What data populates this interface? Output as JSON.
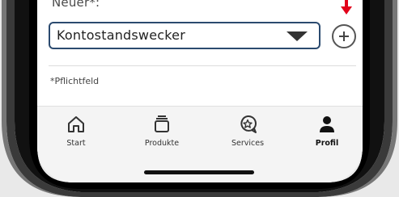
{
  "form": {
    "field_label": "Neuer*:",
    "select_value": "Kontostandswecker",
    "required_note": "*Pflichtfeld"
  },
  "icons": {
    "dropdown": "caret-down-icon",
    "add": "plus-circle-icon",
    "annotation": "red-arrow-down-icon"
  },
  "tabbar": {
    "items": [
      {
        "label": "Start",
        "icon": "home-icon",
        "active": false
      },
      {
        "label": "Produkte",
        "icon": "stack-icon",
        "active": false
      },
      {
        "label": "Services",
        "icon": "service-star-icon",
        "active": false
      },
      {
        "label": "Profil",
        "icon": "person-icon",
        "active": true
      }
    ]
  },
  "colors": {
    "select_border": "#2b4a6f",
    "annotation_arrow": "#e2001a",
    "tabbar_bg": "#f4f4f4"
  }
}
